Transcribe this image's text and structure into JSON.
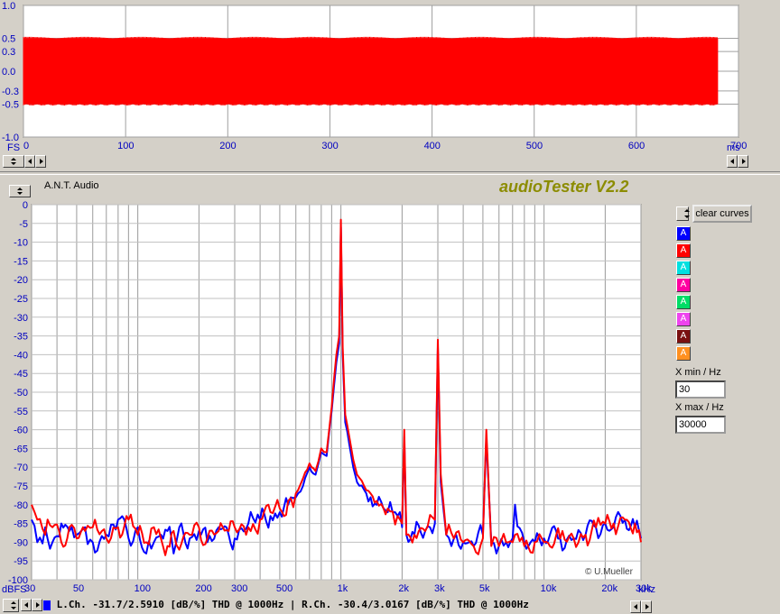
{
  "top_panel": {
    "fs_label": "FS",
    "x_unit": "ms",
    "x_ticks": [
      "0",
      "100",
      "200",
      "300",
      "400",
      "500",
      "600",
      "700"
    ],
    "y_ticks": [
      "1.0",
      "0.5",
      "0.3",
      "0.0",
      "-0.3",
      "-0.5",
      "-1.0"
    ]
  },
  "header": {
    "source": "A.N.T. Audio",
    "app_title": "audioTester V2.2"
  },
  "controls": {
    "clear_button": "clear curves",
    "channels": [
      {
        "label": "A",
        "color": "#0000ff"
      },
      {
        "label": "A",
        "color": "#ff0000"
      },
      {
        "label": "A",
        "color": "#00e0e0"
      },
      {
        "label": "A",
        "color": "#ff00a0"
      },
      {
        "label": "A",
        "color": "#00dd66"
      },
      {
        "label": "A",
        "color": "#ee44ee"
      },
      {
        "label": "A",
        "color": "#7a1010"
      },
      {
        "label": "A",
        "color": "#ff9020"
      }
    ],
    "xmin_label": "X min / Hz",
    "xmin_value": "30",
    "xmax_label": "X max / Hz",
    "xmax_value": "30000"
  },
  "status": {
    "left": "L.Ch. -31.7/2.5910 [dB/%] THD @ 1000Hz",
    "right": "R.Ch. -30.4/3.0167 [dB/%] THD @ 1000Hz"
  },
  "copyright": "© U.Mueller",
  "chart_data": [
    {
      "type": "line",
      "panel": "time-domain",
      "x_unit": "ms",
      "xlim": [
        0,
        700
      ],
      "ylim": [
        -1.0,
        1.0
      ],
      "x_ticks": [
        0,
        100,
        200,
        300,
        400,
        500,
        600,
        700
      ],
      "y_ticks": [
        1.0,
        0.5,
        0.3,
        0.0,
        -0.3,
        -0.5,
        -1.0
      ],
      "series": [
        {
          "color": "#ff0000",
          "x": [
            0,
            680
          ],
          "amplitude": 0.5
        }
      ]
    },
    {
      "type": "line",
      "panel": "spectrum",
      "x_scale": "log",
      "xlim": [
        30,
        30000
      ],
      "ylim": [
        -100,
        0
      ],
      "ylabel": "dBFS",
      "xlabel": "kHz",
      "x_tick_labels": [
        "30",
        "50",
        "100",
        "200",
        "300",
        "500",
        "1k",
        "2k",
        "3k",
        "5k",
        "10k",
        "20k",
        "30k"
      ],
      "x_tick_values": [
        30,
        50,
        100,
        200,
        300,
        500,
        1000,
        2000,
        3000,
        5000,
        10000,
        20000,
        30000
      ],
      "y_ticks": [
        0,
        -5,
        -10,
        -15,
        -20,
        -25,
        -30,
        -35,
        -40,
        -45,
        -50,
        -55,
        -60,
        -65,
        -70,
        -75,
        -80,
        -85,
        -90,
        -95,
        -100
      ],
      "series": [
        {
          "color": "#0000ff",
          "x": [
            30,
            32,
            35,
            38,
            42,
            46,
            50,
            55,
            60,
            70,
            80,
            90,
            100,
            110,
            120,
            130,
            140,
            150,
            160,
            180,
            200,
            220,
            250,
            280,
            300,
            350,
            400,
            450,
            500,
            550,
            600,
            650,
            700,
            750,
            800,
            850,
            900,
            950,
            980,
            1000,
            1020,
            1050,
            1100,
            1150,
            1200,
            1300,
            1400,
            1500,
            1700,
            1900,
            2000,
            2050,
            2100,
            2300,
            2600,
            2900,
            3000,
            3100,
            3300,
            3600,
            4000,
            4500,
            5000,
            5200,
            5500,
            6000,
            6500,
            7000,
            7200,
            8000,
            9000,
            10000,
            12000,
            14000,
            16000,
            18000,
            20000,
            22000,
            25000,
            28000,
            30000
          ],
          "y": [
            -84,
            -90,
            -86,
            -90,
            -85,
            -87,
            -88,
            -86,
            -90,
            -88,
            -84,
            -89,
            -86,
            -93,
            -90,
            -88,
            -87,
            -93,
            -86,
            -89,
            -87,
            -90,
            -86,
            -88,
            -89,
            -85,
            -84,
            -83,
            -82,
            -80,
            -78,
            -75,
            -70,
            -72,
            -66,
            -67,
            -55,
            -42,
            -37,
            -6,
            -40,
            -58,
            -64,
            -70,
            -74,
            -76,
            -78,
            -80,
            -82,
            -83,
            -86,
            -62,
            -88,
            -88,
            -87,
            -85,
            -38,
            -74,
            -88,
            -89,
            -90,
            -91,
            -88,
            -62,
            -90,
            -91,
            -90,
            -89,
            -80,
            -90,
            -90,
            -89,
            -89,
            -89,
            -88,
            -86,
            -85,
            -86,
            -84,
            -86,
            -89
          ]
        },
        {
          "color": "#ff0000",
          "x": [
            30,
            32,
            35,
            38,
            42,
            46,
            50,
            55,
            60,
            70,
            80,
            90,
            100,
            110,
            120,
            130,
            140,
            150,
            160,
            180,
            200,
            220,
            250,
            280,
            300,
            350,
            400,
            450,
            500,
            550,
            600,
            650,
            700,
            750,
            800,
            850,
            900,
            950,
            980,
            1000,
            1020,
            1050,
            1100,
            1150,
            1200,
            1300,
            1400,
            1500,
            1700,
            1900,
            2000,
            2050,
            2100,
            2300,
            2600,
            2900,
            3000,
            3100,
            3300,
            3600,
            4000,
            4500,
            5000,
            5200,
            5500,
            6000,
            6500,
            7000,
            7200,
            8000,
            9000,
            10000,
            12000,
            14000,
            16000,
            18000,
            20000,
            22000,
            25000,
            28000,
            30000
          ],
          "y": [
            -80,
            -84,
            -88,
            -86,
            -90,
            -86,
            -89,
            -87,
            -86,
            -89,
            -86,
            -84,
            -88,
            -90,
            -86,
            -89,
            -91,
            -87,
            -92,
            -88,
            -86,
            -89,
            -87,
            -87,
            -86,
            -86,
            -84,
            -82,
            -81,
            -79,
            -77,
            -73,
            -69,
            -71,
            -65,
            -66,
            -54,
            -40,
            -35,
            -4,
            -38,
            -56,
            -62,
            -68,
            -72,
            -75,
            -77,
            -79,
            -81,
            -83,
            -85,
            -60,
            -88,
            -88,
            -87,
            -84,
            -36,
            -72,
            -88,
            -89,
            -90,
            -91,
            -89,
            -60,
            -91,
            -91,
            -90,
            -90,
            -88,
            -91,
            -90,
            -90,
            -89,
            -89,
            -88,
            -86,
            -85,
            -85,
            -84,
            -85,
            -90
          ]
        }
      ]
    }
  ]
}
